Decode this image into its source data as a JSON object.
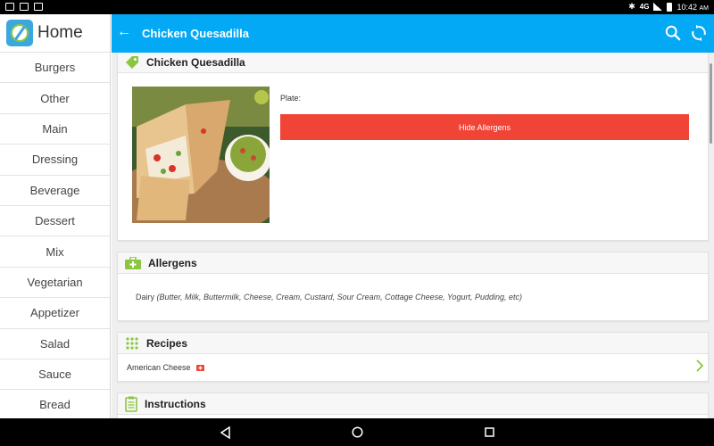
{
  "sidebar": {
    "title": "Home",
    "categories": [
      "Burgers",
      "Other",
      "Main",
      "Dressing",
      "Beverage",
      "Dessert",
      "Mix",
      "Vegetarian",
      "Appetizer",
      "Salad",
      "Sauce",
      "Bread"
    ]
  },
  "status": {
    "network": "4G",
    "time": "10:42",
    "ampm": "AM"
  },
  "toolbar": {
    "title": "Chicken Quesadilla",
    "back_icon": "back-arrow-icon",
    "search_icon": "search-icon",
    "sync_icon": "sync-icon"
  },
  "item_card": {
    "title": "Chicken Quesadilla",
    "plate_label": "Plate:",
    "hide_button": "Hide Allergens",
    "image": "chicken-quesadilla-photo"
  },
  "allergens": {
    "title": "Allergens",
    "category": "Dairy",
    "details": "(Butter, Milk, Buttermilk, Cheese, Cream, Custard, Sour Cream, Cottage Cheese, Yogurt, Pudding, etc)"
  },
  "recipes": {
    "title": "Recipes",
    "items": [
      {
        "name": "American Cheese"
      }
    ]
  },
  "instructions": {
    "title": "Instructions"
  },
  "colors": {
    "toolbar": "#03a9f4",
    "accent_green": "#8cc63f",
    "button_red": "#f04437"
  }
}
